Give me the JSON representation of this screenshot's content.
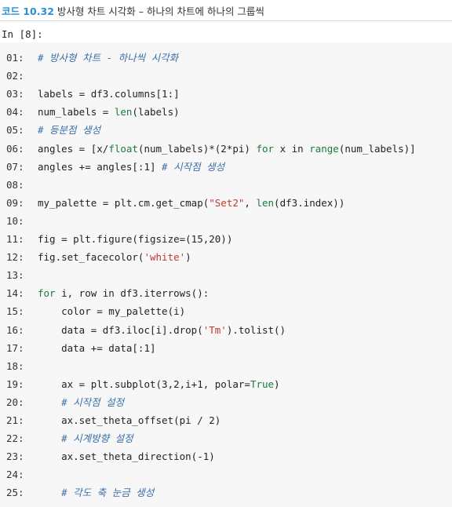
{
  "caption": {
    "label": "코드 10.32",
    "text": " 방사형 차트 시각화 – 하나의 차트에 하나의 그룹씩"
  },
  "cell": {
    "prompt": "In [8]:"
  },
  "lines": [
    {
      "n": "01:",
      "parts": [
        {
          "t": "# 방사형 차트 - 하나씩 시각화",
          "c": "cm"
        }
      ]
    },
    {
      "n": "02:",
      "parts": []
    },
    {
      "n": "03:",
      "parts": [
        {
          "t": "labels = df3.columns[1:]",
          "c": ""
        }
      ]
    },
    {
      "n": "04:",
      "parts": [
        {
          "t": "num_labels = ",
          "c": ""
        },
        {
          "t": "len",
          "c": "bi"
        },
        {
          "t": "(labels)",
          "c": ""
        }
      ]
    },
    {
      "n": "05:",
      "parts": [
        {
          "t": "# 등분점 생성",
          "c": "cm"
        }
      ]
    },
    {
      "n": "06:",
      "parts": [
        {
          "t": "angles = [x/",
          "c": ""
        },
        {
          "t": "float",
          "c": "bi"
        },
        {
          "t": "(num_labels)*(2*pi) ",
          "c": ""
        },
        {
          "t": "for",
          "c": "kw"
        },
        {
          "t": " x in ",
          "c": ""
        },
        {
          "t": "range",
          "c": "bi"
        },
        {
          "t": "(num_labels)]",
          "c": ""
        }
      ]
    },
    {
      "n": "07:",
      "parts": [
        {
          "t": "angles += angles[:1] ",
          "c": ""
        },
        {
          "t": "# 시작점 생성",
          "c": "cm"
        }
      ]
    },
    {
      "n": "08:",
      "parts": []
    },
    {
      "n": "09:",
      "parts": [
        {
          "t": "my_palette = plt.cm.get_cmap(",
          "c": ""
        },
        {
          "t": "\"Set2\"",
          "c": "st"
        },
        {
          "t": ", ",
          "c": ""
        },
        {
          "t": "len",
          "c": "bi"
        },
        {
          "t": "(df3.index))",
          "c": ""
        }
      ]
    },
    {
      "n": "10:",
      "parts": []
    },
    {
      "n": "11:",
      "parts": [
        {
          "t": "fig = plt.figure(figsize=(15,20))",
          "c": ""
        }
      ]
    },
    {
      "n": "12:",
      "parts": [
        {
          "t": "fig.set_facecolor(",
          "c": ""
        },
        {
          "t": "'white'",
          "c": "st"
        },
        {
          "t": ")",
          "c": ""
        }
      ]
    },
    {
      "n": "13:",
      "parts": []
    },
    {
      "n": "14:",
      "parts": [
        {
          "t": "for",
          "c": "kw"
        },
        {
          "t": " i, row in df3.iterrows():",
          "c": ""
        }
      ]
    },
    {
      "n": "15:",
      "parts": [
        {
          "t": "    color = my_palette(i)",
          "c": ""
        }
      ]
    },
    {
      "n": "16:",
      "parts": [
        {
          "t": "    data = df3.iloc[i].drop(",
          "c": ""
        },
        {
          "t": "'Tm'",
          "c": "st"
        },
        {
          "t": ").tolist()",
          "c": ""
        }
      ]
    },
    {
      "n": "17:",
      "parts": [
        {
          "t": "    data += data[:1]",
          "c": ""
        }
      ]
    },
    {
      "n": "18:",
      "parts": []
    },
    {
      "n": "19:",
      "parts": [
        {
          "t": "    ax = plt.subplot(3,2,i+1, polar=",
          "c": ""
        },
        {
          "t": "True",
          "c": "kw"
        },
        {
          "t": ")",
          "c": ""
        }
      ]
    },
    {
      "n": "20:",
      "parts": [
        {
          "t": "    ",
          "c": ""
        },
        {
          "t": "# 시작점 설정",
          "c": "cm"
        }
      ]
    },
    {
      "n": "21:",
      "parts": [
        {
          "t": "    ax.set_theta_offset(pi / 2)",
          "c": ""
        }
      ]
    },
    {
      "n": "22:",
      "parts": [
        {
          "t": "    ",
          "c": ""
        },
        {
          "t": "# 시계방향 설정",
          "c": "cm"
        }
      ]
    },
    {
      "n": "23:",
      "parts": [
        {
          "t": "    ax.set_theta_direction(-1)",
          "c": ""
        }
      ]
    },
    {
      "n": "24:",
      "parts": []
    },
    {
      "n": "25:",
      "parts": [
        {
          "t": "    ",
          "c": ""
        },
        {
          "t": "# 각도 축 눈금 생성",
          "c": "cm"
        }
      ]
    }
  ]
}
